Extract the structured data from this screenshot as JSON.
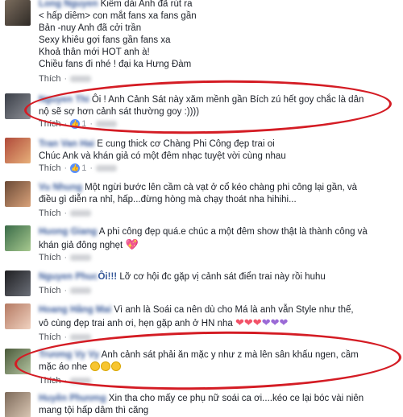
{
  "comments": [
    {
      "author": "Long Nguyen",
      "lines": [
        "Kiếm dài Anh đã rút ra",
        "< hấp diêm> con mắt fans xa fans gần",
        "Bản -nuy Anh đã cởi trần",
        "Sexy khiêu gợi fans gần fans xa",
        "Khoả thân mới HOT anh à!",
        "Chiều fans đi nhé ! đại ka Hưng Đàm"
      ],
      "like": "Thích"
    },
    {
      "author": "Nguyen Thi",
      "text_first": " Ôi ! Anh Cảnh Sát này xăm mềnh gần Bích zú hết goy chắc là dân",
      "text_second": "nộ sẽ sợ hơn cảnh sát thường goy :))))",
      "like": "Thích",
      "like_count": "1"
    },
    {
      "author": "Tran Van Hai",
      "text_first": "E cung thick cơ Chàng Phi Công đẹp trai oi",
      "text_second": "Chúc Ank và khán giả có một đêm nhạc tuyệt vời cùng nhau",
      "like": "Thích",
      "like_count": "1"
    },
    {
      "author": "Vu Nhung",
      "text_first": " Một ngừi bước lên cầm cà vạt ở cổ kéo chàng phi công lại gần, và",
      "text_second": "điều gì diễn ra nhỉ, hấp...đừng hòng mà chạy thoát nha hihihi...",
      "like": "Thích"
    },
    {
      "author": "Huong Giang",
      "text_first": " A phi công đẹp quá.e chúc a một đêm show thật là thành công và",
      "text_second": "khán giả đông nghẹt ",
      "like": "Thích"
    },
    {
      "author": "Nguyen Phuc",
      "author_tail": "Ôi!!!",
      "text_first": " Lỡ cơ hội đc gặp vị cảnh sát điển trai này rồi huhu",
      "like": "Thích"
    },
    {
      "author": "Hoang Hằng Mai",
      "text_first": " Vì anh là Soái ca nên dù cho Má là anh vẫn Style như thế,",
      "text_second": "vô cùng đẹp trai anh ơi, hẹn gặp anh ở HN nha",
      "like": "Thích"
    },
    {
      "author": "Trương Vy Vy",
      "text_first": " Anh cảnh sát phải ăn mặc y như z mà lên sân khấu ngen, cầm",
      "text_second": "mặc áo nhe ",
      "like": "Thích"
    },
    {
      "author": "Huyền Phương",
      "text_first": " Xin tha cho mấy ce phụ nữ soái ca ơi....kéo ce lại bóc vài niên",
      "text_second": "mang tội hấp dâm thì căng"
    }
  ],
  "colors": {
    "link": "#365899",
    "oval": "#d41c24"
  }
}
